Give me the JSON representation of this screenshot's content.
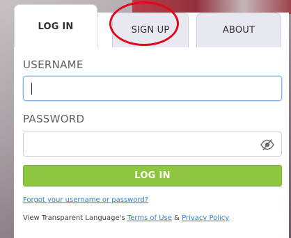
{
  "tabs": {
    "login": "LOG IN",
    "signup": "SIGN UP",
    "about": "ABOUT"
  },
  "form": {
    "username_label": "USERNAME",
    "username_value": "",
    "password_label": "PASSWORD",
    "password_value": "",
    "password_toggle_icon": "eye-slash-icon",
    "submit_label": "LOG IN"
  },
  "links": {
    "forgot": "Forgot your username or password?",
    "legal_prefix": "View Transparent Language's ",
    "terms": "Terms of Use",
    "legal_and": " & ",
    "privacy": "Privacy Policy"
  },
  "annotation": {
    "highlight_color": "#e0061b"
  },
  "colors": {
    "accent_green": "#8dc63f",
    "link_blue": "#2a7ed6",
    "tab_inactive_bg": "#e8e8f1"
  }
}
